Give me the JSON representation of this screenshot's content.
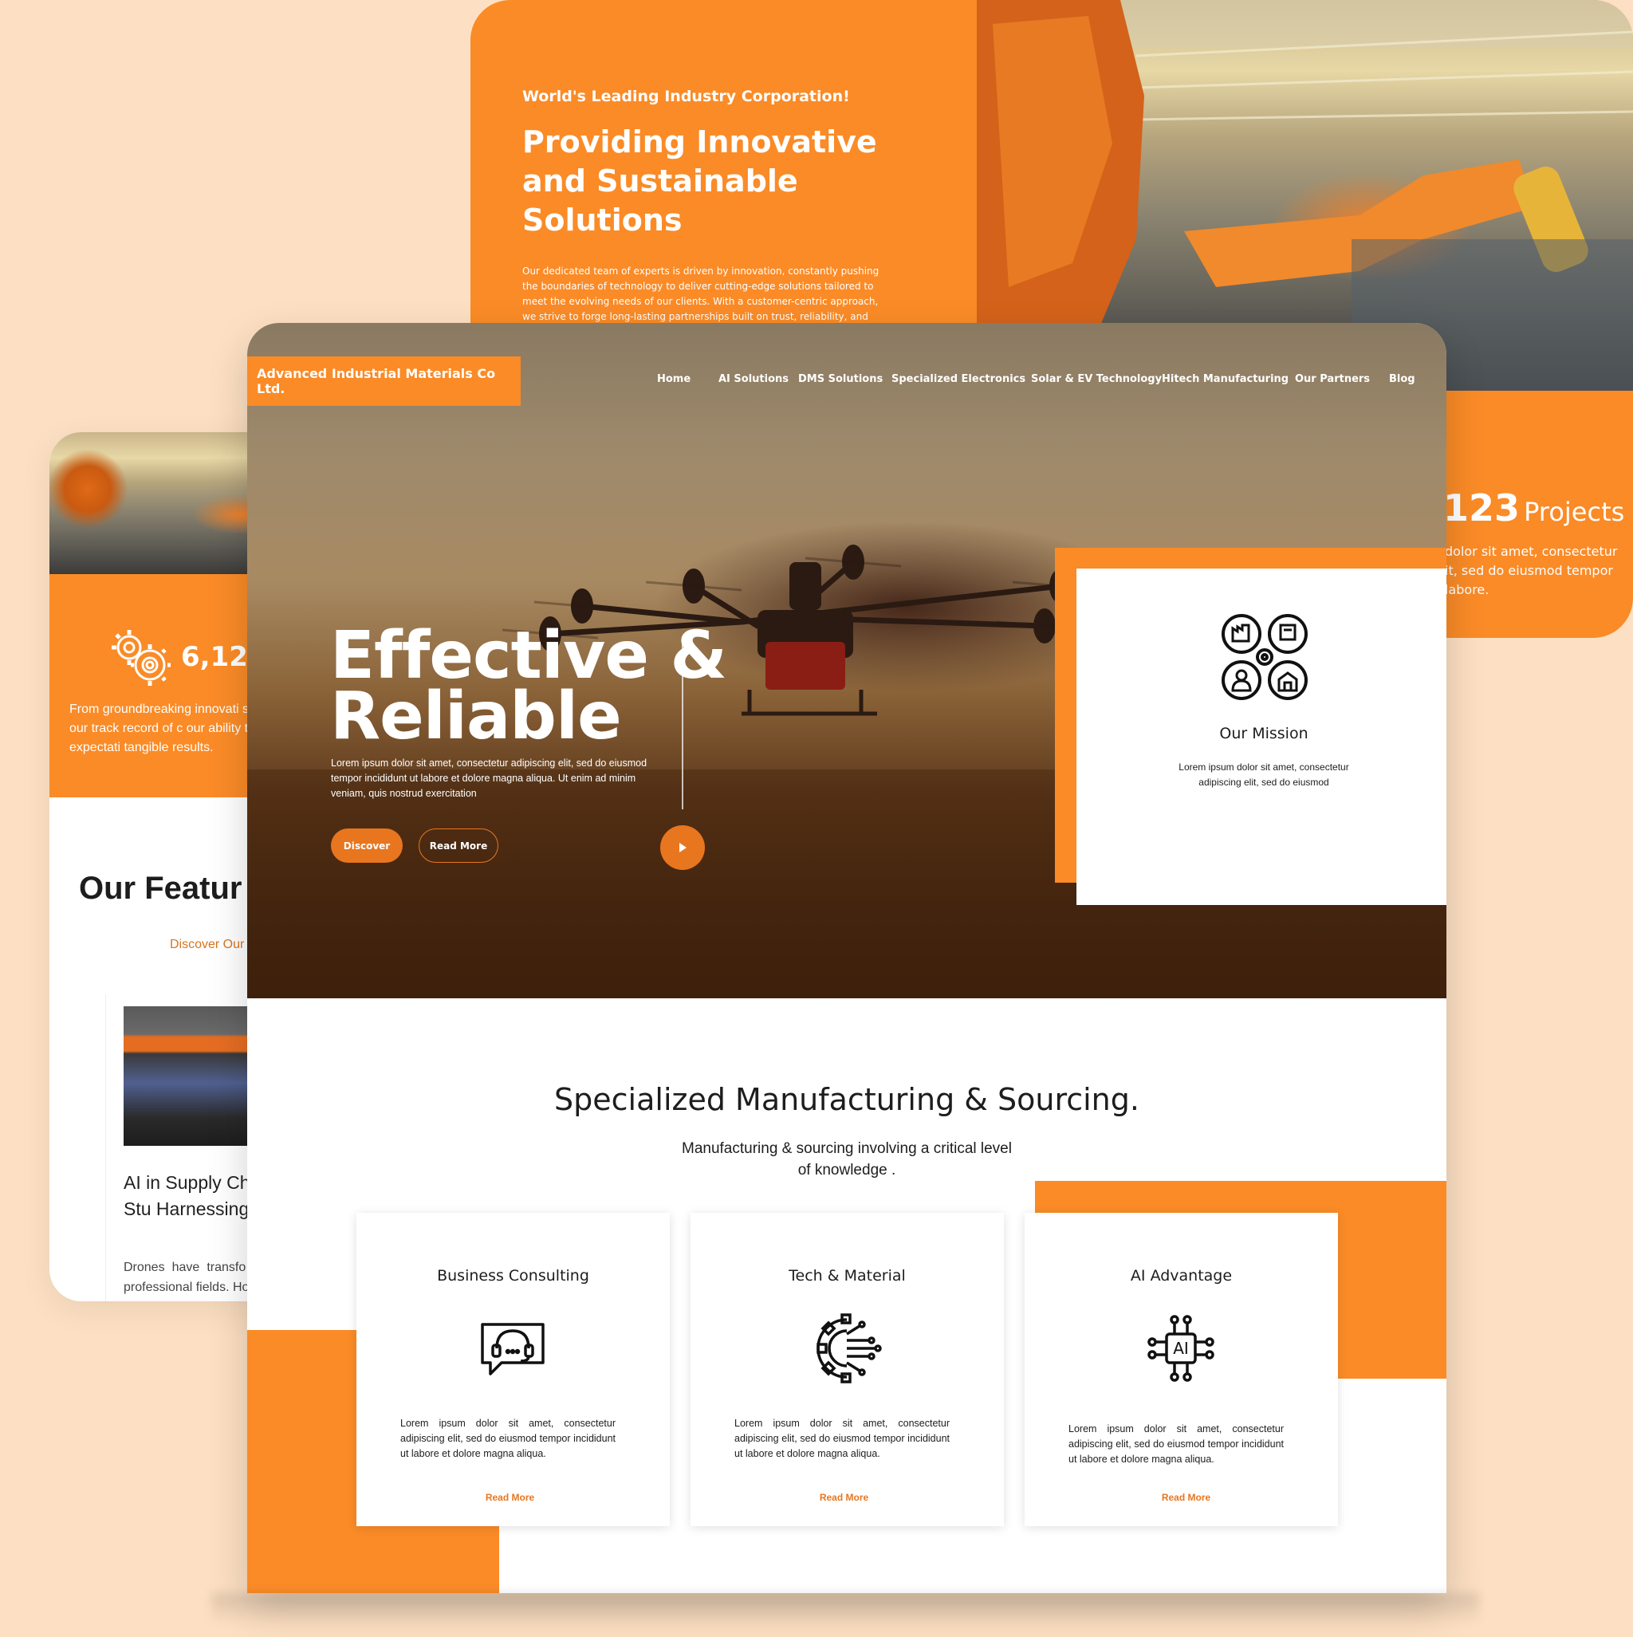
{
  "back_card": {
    "eyebrow": "World's Leading Industry Corporation!",
    "headline": "Providing Innovative and Sustainable Solutions",
    "paragraph": "Our dedicated team of experts is driven by innovation, constantly pushing the boundaries of technology to deliver cutting-edge solutions tailored to meet the evolving needs of our clients. With a customer-centric approach, we strive to forge long-lasting partnerships built on trust, reliability, and exceptional quality.",
    "stat_number": "123",
    "stat_label": "Projects",
    "stat_text": "dolor sit amet, consectetur it, sed do eiusmod tempor labore."
  },
  "left_card": {
    "count": "6,123",
    "paragraph": "From groundbreaking innovati solutions, our track record of c our ability to surpass expectati tangible results.",
    "features_title": "Our Featur",
    "features_link": "Discover Our",
    "blog_title": "AI in Supply Ch world Case Stu Harnessing AI's",
    "blog_text": "Drones have transfo photography, recre professional fields. Ho"
  },
  "main": {
    "brand": "Advanced Industrial Materials Co Ltd.",
    "nav": [
      "Home",
      "AI Solutions",
      "DMS Solutions",
      "Specialized Electronics",
      "Solar & EV Technology",
      "Hitech Manufacturing",
      "Our Partners",
      "Blog"
    ],
    "hero": {
      "title_line1": "Effective &",
      "title_line2": "Reliable",
      "text": "Lorem ipsum dolor sit amet, consectetur adipiscing elit, sed do eiusmod tempor incididunt ut labore et dolore magna aliqua. Ut enim ad minim veniam, quis nostrud exercitation",
      "discover": "Discover",
      "read_more": "Read More"
    },
    "mission": {
      "title": "Our Mission",
      "text": "Lorem ipsum dolor sit amet, consectetur adipiscing elit, sed do eiusmod"
    },
    "section": {
      "title": "Specialized Manufacturing & Sourcing.",
      "subtitle": "Manufacturing & sourcing involving a critical level of knowledge ."
    },
    "services": [
      {
        "title": "Business Consulting",
        "icon": "consulting-headset-icon",
        "text": "Lorem ipsum dolor sit amet, consectetur adipiscing elit, sed do eiusmod tempor incididunt ut labore et dolore magna aliqua.",
        "link": "Read More"
      },
      {
        "title": "Tech & Material",
        "icon": "circuit-gear-icon",
        "text": "Lorem ipsum dolor sit amet, consectetur adipiscing elit, sed do eiusmod tempor incididunt ut labore et dolore magna aliqua.",
        "link": "Read More"
      },
      {
        "title": "AI Advantage",
        "icon": "ai-chip-icon",
        "text": "Lorem ipsum dolor sit amet, consectetur adipiscing elit, sed do eiusmod tempor incididunt ut labore et dolore magna aliqua.",
        "link": "Read More"
      }
    ],
    "ai_icon_label": "AI"
  },
  "colors": {
    "accent": "#fa8b27",
    "accent_dark": "#e8761e",
    "background": "#fde0c3"
  }
}
